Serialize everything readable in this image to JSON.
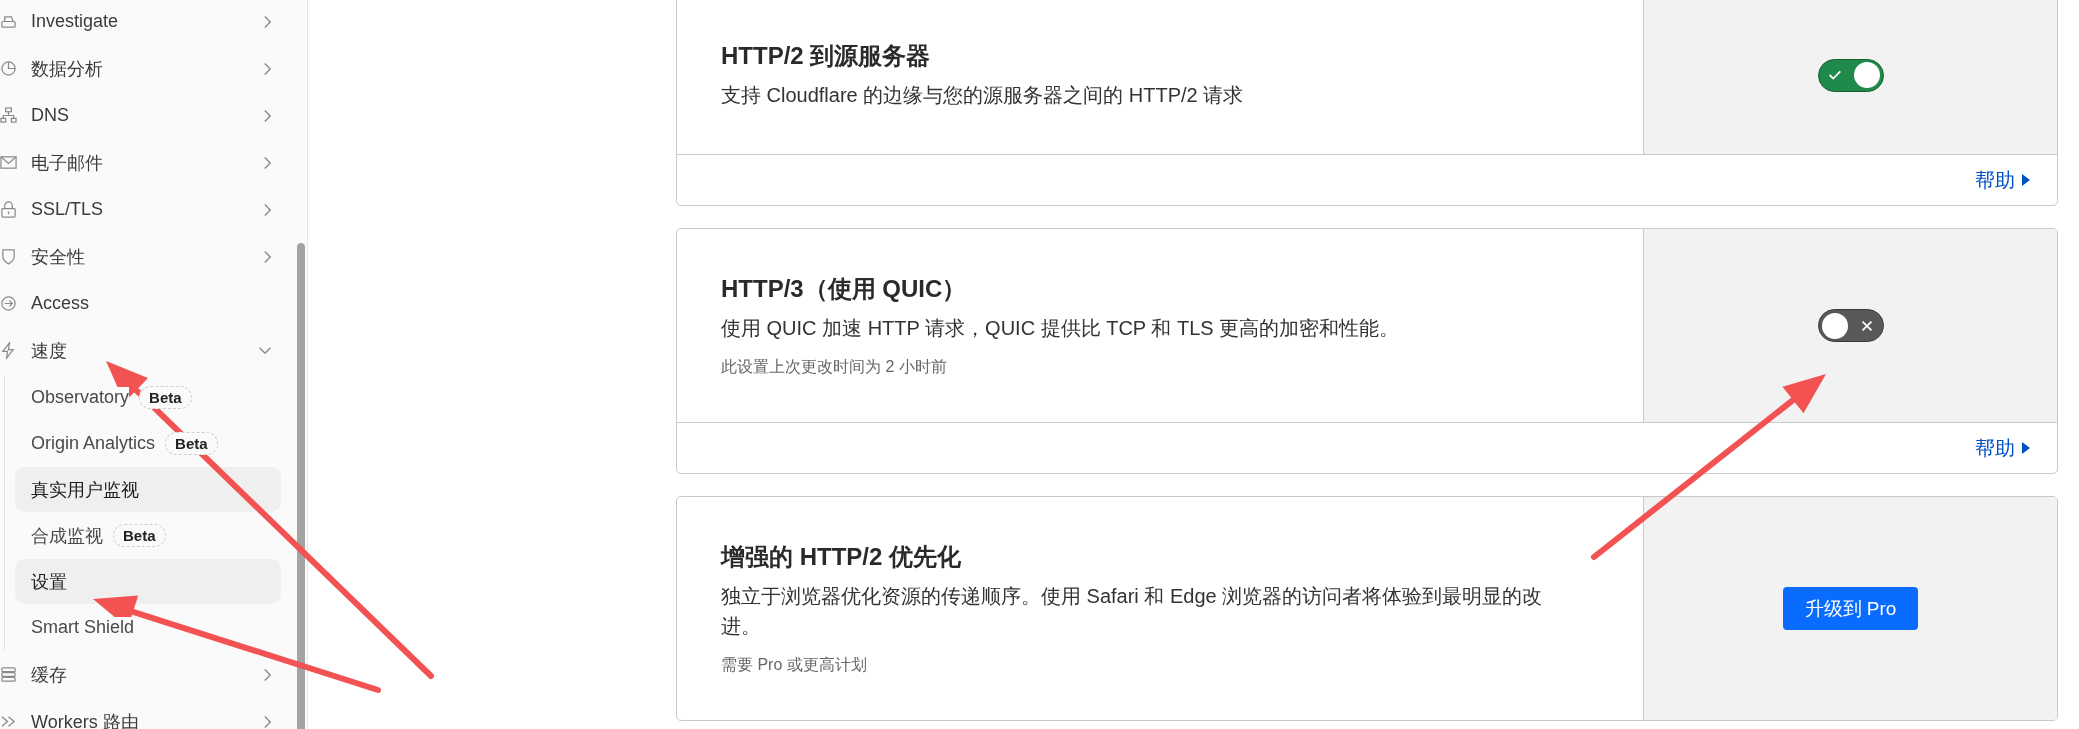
{
  "sidebar": {
    "items": [
      {
        "label": "Investigate",
        "expanded": false
      },
      {
        "label": "数据分析",
        "expanded": false
      },
      {
        "label": "DNS",
        "expanded": false
      },
      {
        "label": "电子邮件",
        "expanded": false
      },
      {
        "label": "SSL/TLS",
        "expanded": false
      },
      {
        "label": "安全性",
        "expanded": false
      },
      {
        "label": "Access"
      },
      {
        "label": "速度",
        "expanded": true,
        "children": [
          {
            "label": "Observatory",
            "badge": "Beta",
            "selected": false
          },
          {
            "label": "Origin Analytics",
            "badge": "Beta",
            "selected": false
          },
          {
            "label": "真实用户监视",
            "selected": true
          },
          {
            "label": "合成监视",
            "badge": "Beta",
            "selected": false
          },
          {
            "label": "设置",
            "selected": true
          },
          {
            "label": "Smart Shield",
            "selected": false
          }
        ]
      },
      {
        "label": "缓存",
        "expanded": false
      },
      {
        "label": "Workers 路由",
        "expanded": false
      }
    ]
  },
  "cards": [
    {
      "title": "HTTP/2 到源服务器",
      "description": "支持 Cloudflare 的边缘与您的源服务器之间的 HTTP/2 请求",
      "control": {
        "kind": "toggle",
        "on": true
      },
      "help": "帮助"
    },
    {
      "title": "HTTP/3（使用 QUIC）",
      "description": "使用 QUIC 加速 HTTP 请求，QUIC 提供比 TCP 和 TLS 更高的加密和性能。",
      "note": "此设置上次更改时间为 2 小时前",
      "control": {
        "kind": "toggle",
        "on": false
      },
      "help": "帮助"
    },
    {
      "title": "增强的 HTTP/2 优先化",
      "description": "独立于浏览器优化资源的传递顺序。使用 Safari 和 Edge 浏览器的访问者将体验到最明显的改进。",
      "note": "需要 Pro 或更高计划",
      "control": {
        "kind": "button",
        "label": "升级到 Pro"
      }
    }
  ]
}
